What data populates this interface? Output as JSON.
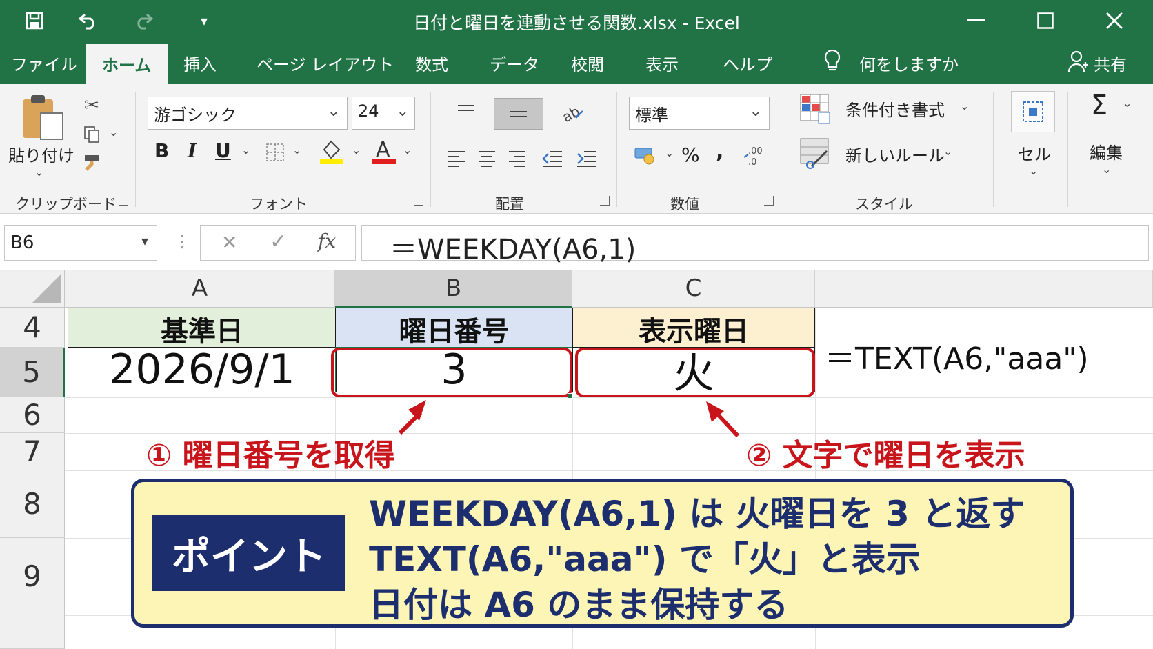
{
  "window": {
    "title": "日付と曜日を連動させる関数.xlsx  -  Excel",
    "quick_access_customize": "="
  },
  "tabs": [
    {
      "label": "ファイル"
    },
    {
      "label": "ホーム"
    },
    {
      "label": "挿入"
    },
    {
      "label": "ページ レイアウト"
    },
    {
      "label": "数式"
    },
    {
      "label": "データ"
    },
    {
      "label": "校閲"
    },
    {
      "label": "表示"
    },
    {
      "label": "ヘルプ"
    },
    {
      "label": "何をしますか"
    }
  ],
  "share_label": "共有",
  "ribbon": {
    "clipboard": {
      "label": "クリップボード",
      "paste": "貼り付け"
    },
    "font": {
      "label": "フォント",
      "name": "游ゴシック",
      "size": "24",
      "bold": "B",
      "italic": "I",
      "underline": "U"
    },
    "alignment": {
      "label": "配置"
    },
    "number": {
      "label": "数値",
      "format": "標準",
      "percent": "%",
      "comma": ","
    },
    "styles": {
      "label": "スタイル",
      "conditional": "条件付き書式",
      "new_rule": "新しいルール"
    },
    "cells": {
      "label": "セル"
    },
    "editing": {
      "label": "編集",
      "sigma": "Σ"
    }
  },
  "formula_bar": {
    "name_box": "B6",
    "fx": "fx",
    "formula": "＝WEEKDAY(A6,1)"
  },
  "columns": [
    "A",
    "B",
    "C"
  ],
  "rows": [
    "4",
    "5",
    "6",
    "7",
    "8",
    "9"
  ],
  "table": {
    "headers": [
      "基準日",
      "曜日番号",
      "表示曜日"
    ],
    "values": [
      "2026/9/1",
      "3",
      "火"
    ]
  },
  "side_formula": "＝TEXT(A6,\"aaa\")",
  "annotations": {
    "one": "① 曜日番号を取得",
    "two": "② 文字で曜日を表示"
  },
  "point": {
    "badge": "ポイント",
    "lines": [
      "WEEKDAY(A6,1) は 火曜日を 3 と返す",
      "TEXT(A6,\"aaa\") で「火」と表示",
      "日付は A6 のまま保持する"
    ]
  },
  "colors": {
    "excel_green": "#217346",
    "header_green": "#e2efda",
    "header_blue": "#dae3f3",
    "header_orange": "#fdf0d0",
    "annotation_red": "#c8151b",
    "point_navy": "#1d2e6e",
    "point_yellow": "#fcf5b6"
  }
}
